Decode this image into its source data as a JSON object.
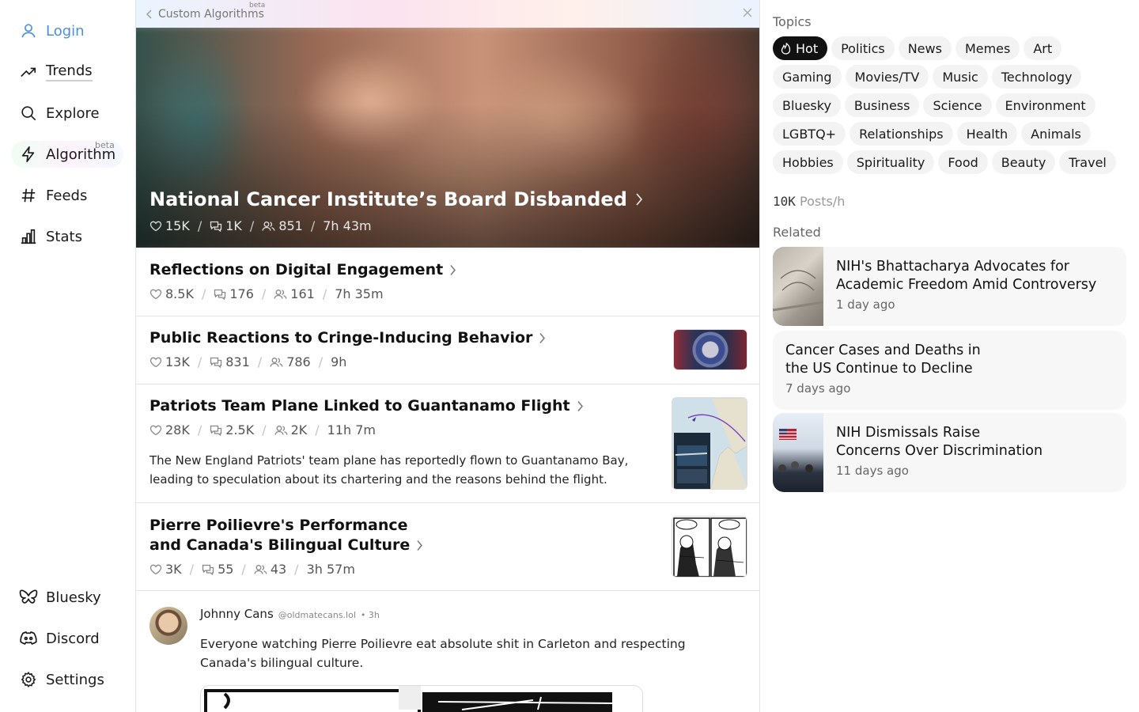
{
  "sidebar": {
    "nav": [
      {
        "label": "Login",
        "icon": "user-icon"
      },
      {
        "label": "Trends",
        "icon": "trending-up-icon"
      },
      {
        "label": "Explore",
        "icon": "search-icon"
      },
      {
        "label": "Algorithm",
        "icon": "bolt-icon",
        "badge": "beta"
      },
      {
        "label": "Feeds",
        "icon": "hash-icon"
      },
      {
        "label": "Stats",
        "icon": "bar-chart-icon"
      }
    ],
    "bottom": [
      {
        "label": "Bluesky",
        "icon": "butterfly-icon"
      },
      {
        "label": "Discord",
        "icon": "discord-icon"
      },
      {
        "label": "Settings",
        "icon": "gear-icon"
      }
    ]
  },
  "topbar": {
    "title": "Custom Algorithms",
    "badge": "beta"
  },
  "hero": {
    "title": "National Cancer Institute’s Board Disbanded",
    "likes": "15K",
    "comments": "1K",
    "users": "851",
    "time": "7h 43m"
  },
  "stories": [
    {
      "title": "Reflections on Digital Engagement",
      "likes": "8.5K",
      "comments": "176",
      "users": "161",
      "time": "7h 35m"
    },
    {
      "title": "Public Reactions to Cringe-Inducing Behavior",
      "likes": "13K",
      "comments": "831",
      "users": "786",
      "time": "9h"
    },
    {
      "title": "Patriots Team Plane Linked to Guantanamo Flight",
      "likes": "28K",
      "comments": "2.5K",
      "users": "2K",
      "time": "11h 7m",
      "summary": "The New England Patriots' team plane has reportedly flown to Guantanamo Bay, leading to speculation about its chartering and the reasons behind the flight."
    },
    {
      "title_line1": "Pierre Poilievre's Performance",
      "title_line2": "and Canada's Bilingual Culture",
      "likes": "3K",
      "comments": "55",
      "users": "43",
      "time": "3h 57m"
    }
  ],
  "post": {
    "author": "Johnny Cans",
    "handle": "@oldmatecans.lol",
    "age": "• 3h",
    "text": "Everyone watching Pierre Poilievre eat absolute shit in Carleton and respecting Canada's bilingual culture."
  },
  "right": {
    "topics_label": "Topics",
    "topics": [
      "Hot",
      "Politics",
      "News",
      "Memes",
      "Art",
      "Gaming",
      "Movies/TV",
      "Music",
      "Technology",
      "Bluesky",
      "Business",
      "Science",
      "Environment",
      "LGBTQ+",
      "Relationships",
      "Health",
      "Animals",
      "Hobbies",
      "Spirituality",
      "Food",
      "Beauty",
      "Travel"
    ],
    "active_topic": "Hot",
    "rate_value": "10K",
    "rate_unit": "Posts/h",
    "related_label": "Related",
    "related": [
      {
        "line1": "NIH's Bhattacharya Advocates for",
        "line2": "Academic Freedom Amid Controversy",
        "ago": "1 day ago"
      },
      {
        "line1": "Cancer Cases and Deaths in",
        "line2": "the US Continue to Decline",
        "ago": "7 days ago"
      },
      {
        "line1": "NIH Dismissals Raise",
        "line2": "Concerns Over Discrimination",
        "ago": "11 days ago"
      }
    ]
  },
  "colors": {
    "accent_login": "#4a8fdd",
    "chip_active_bg": "#111111",
    "chip_bg": "#f3f3f3"
  }
}
